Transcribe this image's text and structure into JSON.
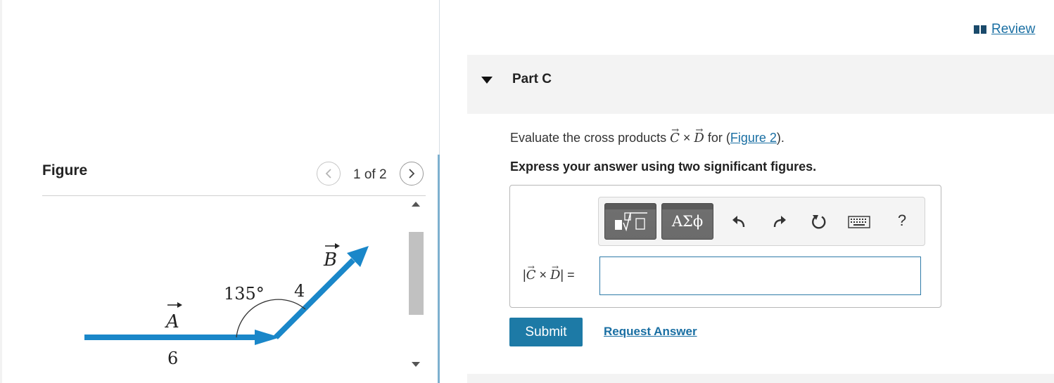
{
  "left_panel": {
    "figure_title": "Figure",
    "pager": {
      "text": "1 of 2",
      "prev_icon": "chevron-left-icon",
      "next_icon": "chevron-right-icon"
    },
    "figure": {
      "vector_a_label": "A",
      "vector_a_magnitude": "6",
      "vector_b_label": "B",
      "vector_b_magnitude": "4",
      "angle_label": "135°",
      "arrow_color": "#1a87c9"
    }
  },
  "right_panel": {
    "review_label": "Review",
    "review_icon": "book-icon",
    "part": {
      "title": "Part C",
      "caret_icon": "caret-down-icon"
    },
    "question": {
      "prefix": "Evaluate the cross products ",
      "vec_c": "C",
      "times": " × ",
      "vec_d": "D",
      "for_text": " for (",
      "figure_link": "Figure 2",
      "suffix": ")."
    },
    "instruction": "Express your answer using two significant figures.",
    "toolbar": {
      "templates_icon": "templates-icon",
      "symbols_label": "ΑΣϕ",
      "undo_icon": "undo-icon",
      "redo_icon": "redo-icon",
      "reset_icon": "reset-icon",
      "keyboard_icon": "keyboard-icon",
      "help_label": "?"
    },
    "answer": {
      "lhs_open": "|",
      "lhs_c": "C",
      "lhs_times": " × ",
      "lhs_d": "D",
      "lhs_close": "| =",
      "value": "",
      "placeholder": ""
    },
    "submit_label": "Submit",
    "request_answer_label": "Request Answer"
  },
  "colors": {
    "accent": "#1d7aa6",
    "link": "#1a6fa3",
    "header_bg": "#f3f3f3"
  }
}
